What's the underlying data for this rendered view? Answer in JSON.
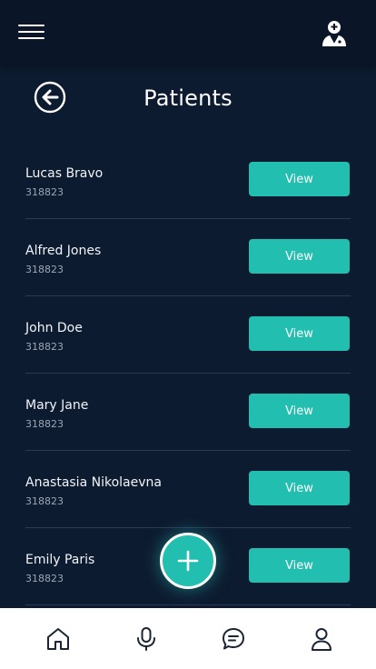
{
  "header": {
    "title": "Patients"
  },
  "patients": [
    {
      "name": "Lucas Bravo",
      "id": "318823",
      "action": "View"
    },
    {
      "name": "Alfred Jones",
      "id": "318823",
      "action": "View"
    },
    {
      "name": "John Doe",
      "id": "318823",
      "action": "View"
    },
    {
      "name": "Mary Jane",
      "id": "318823",
      "action": "View"
    },
    {
      "name": "Anastasia Nikolaevna",
      "id": "318823",
      "action": "View"
    },
    {
      "name": "Emily Paris",
      "id": "318823",
      "action": "View"
    }
  ],
  "icons": {
    "menu": "hamburger-menu-icon",
    "profile": "doctor-icon",
    "back": "arrow-left-circle-icon",
    "fab": "plus-icon",
    "nav": [
      "home-icon",
      "microphone-icon",
      "chat-icon",
      "user-icon"
    ]
  },
  "colors": {
    "background": "#0d1b30",
    "topbar": "#0a1628",
    "accent": "#22bfb1",
    "divider": "#2a3a52",
    "bottom_nav": "#ffffff",
    "nav_icon": "#1b2536"
  }
}
